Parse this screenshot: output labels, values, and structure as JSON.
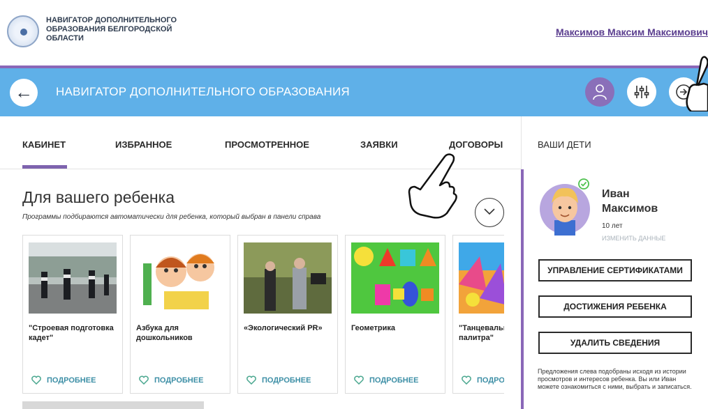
{
  "header": {
    "org_name": "НАВИГАТОР ДОПОЛНИТЕЛЬНОГО ОБРАЗОВАНИЯ БЕЛГОРОДСКОЙ ОБЛАСТИ",
    "user_name": "Максимов Максим Максимович"
  },
  "navbar": {
    "title": "НАВИГАТОР ДОПОЛНИТЕЛЬНОГО ОБРАЗОВАНИЯ"
  },
  "tabs": [
    {
      "label": "КАБИНЕТ",
      "active": true
    },
    {
      "label": "ИЗБРАННОЕ",
      "active": false
    },
    {
      "label": "ПРОСМОТРЕННОЕ",
      "active": false
    },
    {
      "label": "ЗАЯВКИ",
      "active": false
    },
    {
      "label": "ДОГОВОРЫ",
      "active": false
    }
  ],
  "main": {
    "title": "Для вашего ребенка",
    "subtitle": "Программы подбираются автоматически для ребенка, который выбран в панели справа",
    "more_label": "ПОДРОБНЕЕ",
    "cards": [
      {
        "title": "\"Строевая подготовка кадет\""
      },
      {
        "title": "Азбука для дошкольников"
      },
      {
        "title": "«Экологический PR»"
      },
      {
        "title": "Геометрика"
      },
      {
        "title": "\"Танцевальная палитра\""
      }
    ]
  },
  "sidebar": {
    "heading": "ВАШИ ДЕТИ",
    "child": {
      "first_name": "Иван",
      "last_name": "Максимов",
      "age": "10 лет",
      "edit_label": "ИЗМЕНИТЬ ДАННЫЕ"
    },
    "buttons": [
      "УПРАВЛЕНИЕ СЕРТИФИКАТАМИ",
      "ДОСТИЖЕНИЯ РЕБЕНКА",
      "УДАЛИТЬ СВЕДЕНИЯ"
    ],
    "note": "Предложения слева подобраны исходя из истории просмотров и интересов ребенка. Вы или Иван можете ознакомиться с ними, выбрать и записаться."
  },
  "colors": {
    "accent_purple": "#8a67b8",
    "nav_blue": "#5fb0e8",
    "link_teal": "#3d8fa6"
  }
}
